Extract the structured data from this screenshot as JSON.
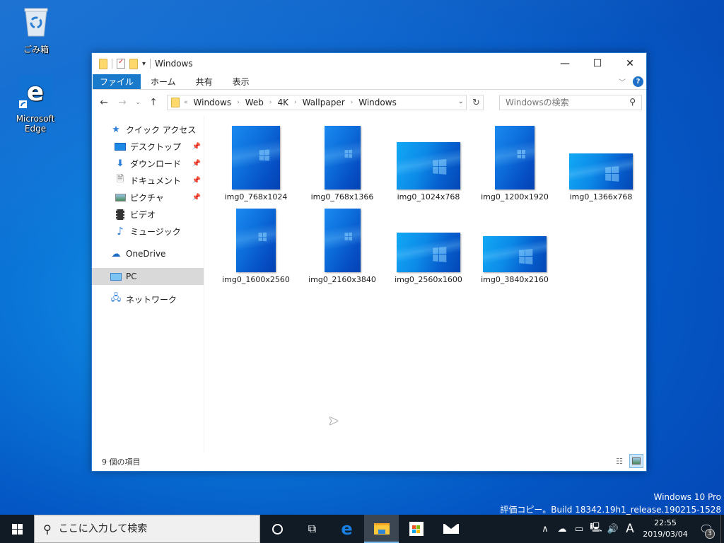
{
  "desktop": {
    "icons": [
      {
        "label": "ごみ箱",
        "icon": "recycle-bin-icon"
      },
      {
        "label": "Microsoft Edge",
        "icon": "edge-icon"
      }
    ],
    "watermark": {
      "line1": "Windows 10 Pro",
      "line2": "評価コピー。Build 18342.19h1_release.190215-1528"
    }
  },
  "window": {
    "title": "Windows",
    "caption": {
      "minimize": "—",
      "maximize": "☐",
      "close": "✕"
    },
    "ribbon_tabs": [
      "ファイル",
      "ホーム",
      "共有",
      "表示"
    ],
    "help": "?",
    "nav": {
      "back": "←",
      "forward": "→",
      "recent": "⌄",
      "up": "↑"
    },
    "address": {
      "overflow": "«",
      "crumbs": [
        "Windows",
        "Web",
        "4K",
        "Wallpaper",
        "Windows"
      ],
      "separator": "›"
    },
    "search": {
      "placeholder": "Windowsの検索"
    },
    "navpane": {
      "quick_access": "クイック アクセス",
      "quick_items": [
        {
          "label": "デスクトップ",
          "icon": "desktop-folder-icon",
          "pinned": true
        },
        {
          "label": "ダウンロード",
          "icon": "downloads-icon",
          "pinned": true
        },
        {
          "label": "ドキュメント",
          "icon": "documents-icon",
          "pinned": true
        },
        {
          "label": "ピクチャ",
          "icon": "pictures-icon",
          "pinned": true
        },
        {
          "label": "ビデオ",
          "icon": "videos-icon",
          "pinned": false
        },
        {
          "label": "ミュージック",
          "icon": "music-icon",
          "pinned": false
        }
      ],
      "onedrive": "OneDrive",
      "pc": "PC",
      "network": "ネットワーク",
      "selected": "PC"
    },
    "files": [
      {
        "name": "img0_768x1024",
        "orientation": "portrait",
        "aspect": "3:4"
      },
      {
        "name": "img0_768x1366",
        "orientation": "portrait",
        "aspect": "9:16"
      },
      {
        "name": "img0_1024x768",
        "orientation": "landscape",
        "aspect": "4:3"
      },
      {
        "name": "img0_1200x1920",
        "orientation": "portrait",
        "aspect": "5:8"
      },
      {
        "name": "img0_1366x768",
        "orientation": "landscape",
        "aspect": "16:9"
      },
      {
        "name": "img0_1600x2560",
        "orientation": "portrait",
        "aspect": "5:8"
      },
      {
        "name": "img0_2160x3840",
        "orientation": "portrait",
        "aspect": "9:16"
      },
      {
        "name": "img0_2560x1600",
        "orientation": "landscape",
        "aspect": "8:5"
      },
      {
        "name": "img0_3840x2160",
        "orientation": "landscape",
        "aspect": "16:9"
      }
    ],
    "status": "9 個の項目",
    "view_mode": "large-icons"
  },
  "taskbar": {
    "search_placeholder": "ここに入力して検索",
    "apps": [
      {
        "name": "cortana",
        "active": false
      },
      {
        "name": "task-view",
        "active": false
      },
      {
        "name": "edge",
        "active": false
      },
      {
        "name": "file-explorer",
        "active": true
      },
      {
        "name": "store",
        "active": false
      },
      {
        "name": "mail",
        "active": false
      }
    ],
    "tray": {
      "ime": "A",
      "time": "22:55",
      "date": "2019/03/04",
      "notifications": "3"
    }
  }
}
